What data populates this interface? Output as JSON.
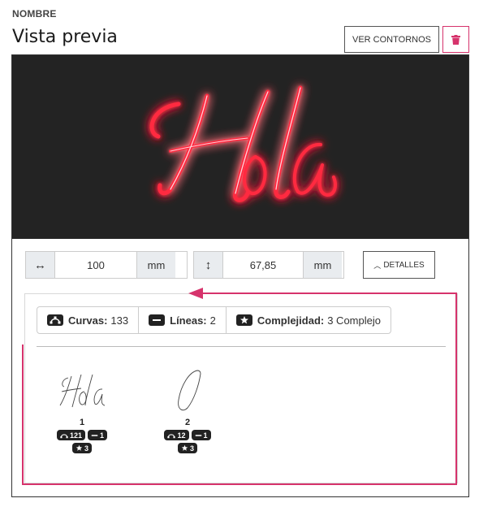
{
  "header": {
    "section_label": "NOMBRE",
    "title": "Vista previa",
    "contours_button": "VER CONTORNOS"
  },
  "preview": {
    "text": "Hola",
    "neon_color": "#ff1030",
    "background": "#232323"
  },
  "dimensions": {
    "width_value": "100",
    "width_unit": "mm",
    "height_value": "67,85",
    "height_unit": "mm",
    "details_label": "DETALLES"
  },
  "stats": {
    "curves_label": "Curvas:",
    "curves_value": "133",
    "lines_label": "Líneas:",
    "lines_value": "2",
    "complexity_label": "Complejidad:",
    "complexity_value": "3 Complejo"
  },
  "shapes": [
    {
      "number": "1",
      "curves": "121",
      "lines": "1",
      "complexity": "3"
    },
    {
      "number": "2",
      "curves": "12",
      "lines": "1",
      "complexity": "3"
    }
  ],
  "colors": {
    "accent": "#d6336c",
    "badge_bg": "#222222"
  }
}
